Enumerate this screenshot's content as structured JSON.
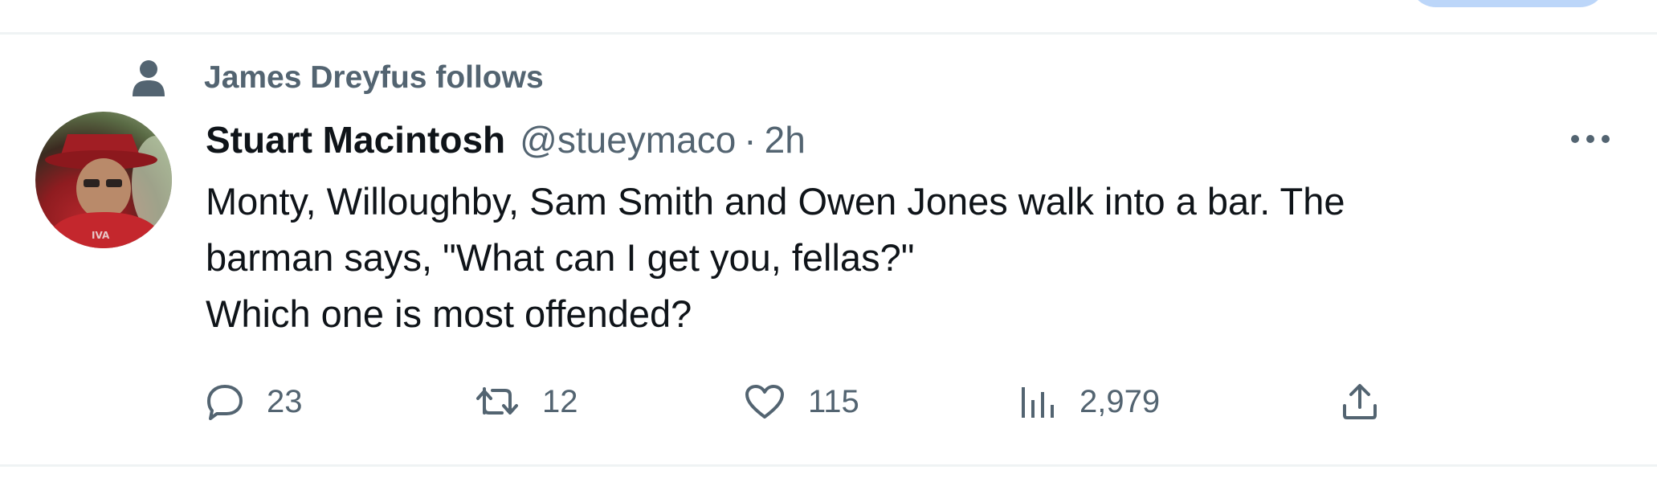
{
  "social_context": {
    "text": "James Dreyfus follows",
    "icon": "person-icon"
  },
  "tweet": {
    "author": {
      "display_name": "Stuart Macintosh",
      "handle": "@stueymaco",
      "avatar_icon": "user-avatar"
    },
    "separator": "·",
    "time": "2h",
    "text": "Monty, Willoughby, Sam Smith and Owen Jones walk into a bar. The\nbarman says, \"What can I get you, fellas?\"\nWhich one is most offended?",
    "more_icon": "more-horizontal-icon"
  },
  "actions": {
    "reply": {
      "icon": "reply-icon",
      "count": "23"
    },
    "retweet": {
      "icon": "retweet-icon",
      "count": "12"
    },
    "like": {
      "icon": "heart-icon",
      "count": "115"
    },
    "views": {
      "icon": "views-chart-icon",
      "count": "2,979"
    },
    "share": {
      "icon": "share-icon"
    }
  },
  "colors": {
    "primary_text": "#0f1419",
    "secondary_text": "#536471",
    "divider": "#eff3f4",
    "accent_pill": "#bcd6f9"
  }
}
